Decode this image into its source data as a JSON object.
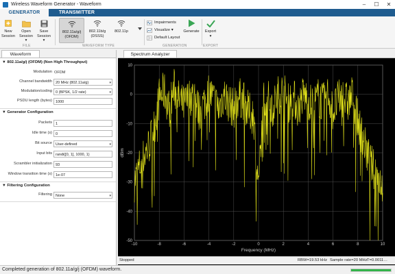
{
  "window": {
    "title": "Wireless Waveform Generator - Waveform"
  },
  "tabs": [
    "GENERATOR",
    "TRANSMITTER"
  ],
  "ribbon": {
    "file": {
      "label": "FILE",
      "buttons": [
        "New\nSession",
        "Open\nSession ▾",
        "Save\nSession ▾"
      ]
    },
    "waveform_type": {
      "label": "WAVEFORM TYPE",
      "buttons": [
        "802.11a/g/j\n(OFDM)",
        "802.11b/g\n(DSSS)",
        "802.11p"
      ]
    },
    "generation": {
      "label": "GENERATION",
      "impairments": "Impairments",
      "visualize": "Visualize ▾",
      "default_layout": "Default Layout",
      "generate": "Generate"
    },
    "export": {
      "label": "EXPORT",
      "export_btn": "Export\n▾"
    }
  },
  "left_panel": {
    "tab": "Waveform",
    "section1": {
      "title": "▼ 802.11a/g/j (OFDM) (Non High Throughput)",
      "modulation_label": "Modulation",
      "modulation_value": "OFDM",
      "channel_bw_label": "Channel bandwidth",
      "channel_bw_value": "20 MHz (802.11a/g)",
      "modcoding_label": "Modulation/coding",
      "modcoding_value": "0 (BPSK, 1/2 rate)",
      "psdu_label": "PSDU length (bytes)",
      "psdu_value": "1000"
    },
    "section2": {
      "title": "▼ Generator Configuration",
      "packets_label": "Packets",
      "packets_value": "1",
      "idle_label": "Idle time (s)",
      "idle_value": "0",
      "bitsource_label": "Bit source",
      "bitsource_value": "User-defined",
      "inputbits_label": "Input bits",
      "inputbits_value": "randi([0, 1], 1000, 1)",
      "scrambler_label": "Scrambler initialization",
      "scrambler_value": "93",
      "window_label": "Window transition time (s)",
      "window_value": "1e-07"
    },
    "section3": {
      "title": "▼ Filtering Configuration",
      "filtering_label": "Filtering",
      "filtering_value": "None"
    }
  },
  "right_panel": {
    "tab": "Spectrum Analyzer",
    "status_left": "Stopped",
    "rbw": "RBW=19.53 kHz",
    "sample_rate": "Sample rate=20 MHz",
    "time": "T=0.0011…"
  },
  "statusbar": {
    "message": "Completed generation of 802.11a/g/j (OFDM) waveform.",
    "progress": 1.0
  },
  "colors": {
    "trace": "#e5e51a",
    "grid": "#505050",
    "tabbar": "#1f5c8f",
    "progress": "#33b34a"
  },
  "chart_data": {
    "type": "line",
    "xlabel": "Frequency (MHz)",
    "ylabel": "dBm",
    "xlim": [
      -10,
      10
    ],
    "ylim": [
      -50,
      10
    ],
    "xticks": [
      -10,
      -8,
      -6,
      -4,
      -2,
      0,
      2,
      4,
      6,
      8,
      10
    ],
    "yticks": [
      10,
      0,
      -10,
      -20,
      -30,
      -40,
      -50
    ],
    "grid": true,
    "series": [
      {
        "x": [
          -10,
          -9.6,
          -9.2,
          -8.8,
          -8.4,
          -8.0,
          -7.6,
          -7.2,
          -6.8,
          -6.4,
          -6.0,
          -5.6,
          -5.2,
          -4.8,
          -4.4,
          -4.0,
          -3.6,
          -3.2,
          -2.8,
          -2.4,
          -2.0,
          -1.6,
          -1.2,
          -0.8,
          -0.4,
          0.0,
          0.4,
          0.8,
          1.2,
          1.6,
          2.0,
          2.4,
          2.8,
          3.2,
          3.6,
          4.0,
          4.4,
          4.8,
          5.2,
          5.6,
          6.0,
          6.4,
          6.8,
          7.2,
          7.6,
          8.0,
          8.4,
          8.8,
          9.2,
          9.6,
          10
        ],
        "y": [
          -27,
          -22,
          -18,
          -14,
          -8,
          2,
          4,
          -2,
          5,
          1,
          -1,
          2,
          3,
          -3,
          0,
          4,
          1,
          -2,
          3,
          0,
          -2,
          2,
          1,
          -3,
          -4,
          -30,
          2,
          1,
          -1,
          3,
          4,
          0,
          2,
          -2,
          3,
          1,
          -1,
          2,
          0,
          3,
          -3,
          1,
          2,
          0,
          3,
          -6,
          -12,
          -18,
          -22,
          -25,
          -28
        ]
      }
    ]
  }
}
